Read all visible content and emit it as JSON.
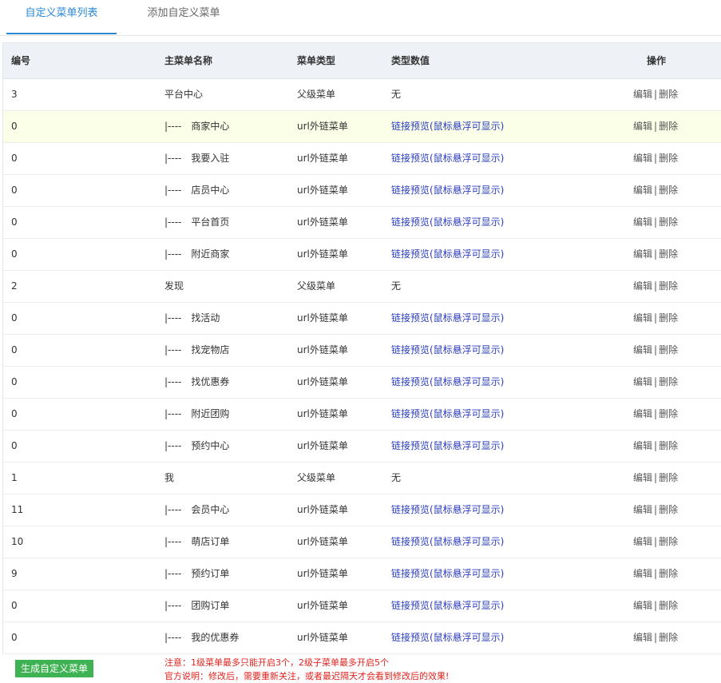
{
  "tabs": [
    {
      "label": "自定义菜单列表",
      "active": true
    },
    {
      "label": "添加自定义菜单",
      "active": false
    }
  ],
  "table": {
    "headers": [
      "编号",
      "主菜单名称",
      "菜单类型",
      "类型数值",
      "操作"
    ],
    "rows": [
      {
        "id": "3",
        "prefix": "",
        "name": "平台中心",
        "type": "父级菜单",
        "value": "无",
        "is_link": false,
        "highlight": false
      },
      {
        "id": "0",
        "prefix": "|----",
        "name": "商家中心",
        "type": "url外链菜单",
        "value": "链接预览(鼠标悬浮可显示)",
        "is_link": true,
        "highlight": true
      },
      {
        "id": "0",
        "prefix": "|----",
        "name": "我要入驻",
        "type": "url外链菜单",
        "value": "链接预览(鼠标悬浮可显示)",
        "is_link": true,
        "highlight": false
      },
      {
        "id": "0",
        "prefix": "|----",
        "name": "店员中心",
        "type": "url外链菜单",
        "value": "链接预览(鼠标悬浮可显示)",
        "is_link": true,
        "highlight": false
      },
      {
        "id": "0",
        "prefix": "|----",
        "name": "平台首页",
        "type": "url外链菜单",
        "value": "链接预览(鼠标悬浮可显示)",
        "is_link": true,
        "highlight": false
      },
      {
        "id": "0",
        "prefix": "|----",
        "name": "附近商家",
        "type": "url外链菜单",
        "value": "链接预览(鼠标悬浮可显示)",
        "is_link": true,
        "highlight": false
      },
      {
        "id": "2",
        "prefix": "",
        "name": "发现",
        "type": "父级菜单",
        "value": "无",
        "is_link": false,
        "highlight": false
      },
      {
        "id": "0",
        "prefix": "|----",
        "name": "找活动",
        "type": "url外链菜单",
        "value": "链接预览(鼠标悬浮可显示)",
        "is_link": true,
        "highlight": false
      },
      {
        "id": "0",
        "prefix": "|----",
        "name": "找宠物店",
        "type": "url外链菜单",
        "value": "链接预览(鼠标悬浮可显示)",
        "is_link": true,
        "highlight": false
      },
      {
        "id": "0",
        "prefix": "|----",
        "name": "找优惠券",
        "type": "url外链菜单",
        "value": "链接预览(鼠标悬浮可显示)",
        "is_link": true,
        "highlight": false
      },
      {
        "id": "0",
        "prefix": "|----",
        "name": "附近团购",
        "type": "url外链菜单",
        "value": "链接预览(鼠标悬浮可显示)",
        "is_link": true,
        "highlight": false
      },
      {
        "id": "0",
        "prefix": "|----",
        "name": "预约中心",
        "type": "url外链菜单",
        "value": "链接预览(鼠标悬浮可显示)",
        "is_link": true,
        "highlight": false
      },
      {
        "id": "1",
        "prefix": "",
        "name": "我",
        "type": "父级菜单",
        "value": "无",
        "is_link": false,
        "highlight": false
      },
      {
        "id": "11",
        "prefix": "|----",
        "name": "会员中心",
        "type": "url外链菜单",
        "value": "链接预览(鼠标悬浮可显示)",
        "is_link": true,
        "highlight": false
      },
      {
        "id": "10",
        "prefix": "|----",
        "name": "萌店订单",
        "type": "url外链菜单",
        "value": "链接预览(鼠标悬浮可显示)",
        "is_link": true,
        "highlight": false
      },
      {
        "id": "9",
        "prefix": "|----",
        "name": "预约订单",
        "type": "url外链菜单",
        "value": "链接预览(鼠标悬浮可显示)",
        "is_link": true,
        "highlight": false
      },
      {
        "id": "0",
        "prefix": "|----",
        "name": "团购订单",
        "type": "url外链菜单",
        "value": "链接预览(鼠标悬浮可显示)",
        "is_link": true,
        "highlight": false
      },
      {
        "id": "0",
        "prefix": "|----",
        "name": "我的优惠券",
        "type": "url外链菜单",
        "value": "链接预览(鼠标悬浮可显示)",
        "is_link": true,
        "highlight": false
      }
    ],
    "actions": {
      "edit": "编辑",
      "separator": "|",
      "delete": "删除"
    }
  },
  "footer": {
    "generate_button": "生成自定义菜单",
    "note1": "注意：1级菜单最多只能开启3个，2级子菜单最多开启5个",
    "note2": "官方说明：修改后，需要重新关注，或者最迟隔天才会看到修改后的效果!"
  },
  "colors": {
    "accent": "#2a88d6",
    "link": "#2b3dbf",
    "button_green": "#3fb354",
    "warning_red": "#e0221d",
    "highlight_row": "#fbffe8"
  }
}
